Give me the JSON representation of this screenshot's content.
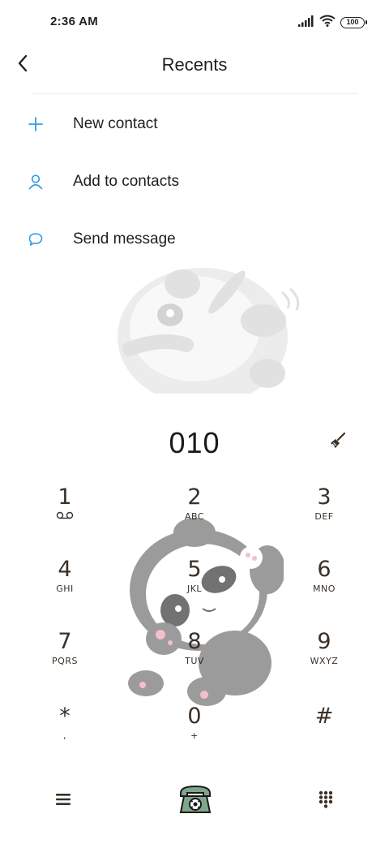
{
  "status_bar": {
    "time": "2:36 AM",
    "battery": "100",
    "icons": [
      "signal-icon",
      "wifi-icon",
      "battery-icon"
    ]
  },
  "header": {
    "title": "Recents",
    "back_icon": "chevron-left-icon"
  },
  "actions": [
    {
      "label": "New contact",
      "icon": "plus-icon"
    },
    {
      "label": "Add to contacts",
      "icon": "person-icon"
    },
    {
      "label": "Send message",
      "icon": "chat-bubble-icon"
    }
  ],
  "dialer": {
    "number": "010",
    "clear_icon": "broom-icon"
  },
  "keypad": {
    "keys": [
      {
        "digit": "1",
        "letters": "voicemail"
      },
      {
        "digit": "2",
        "letters": "ABC"
      },
      {
        "digit": "3",
        "letters": "DEF"
      },
      {
        "digit": "4",
        "letters": "GHI"
      },
      {
        "digit": "5",
        "letters": "JKL"
      },
      {
        "digit": "6",
        "letters": "MNO"
      },
      {
        "digit": "7",
        "letters": "PQRS"
      },
      {
        "digit": "8",
        "letters": "TUV"
      },
      {
        "digit": "9",
        "letters": "WXYZ"
      },
      {
        "digit": "*",
        "letters": ","
      },
      {
        "digit": "0",
        "letters": "+"
      },
      {
        "digit": "#",
        "letters": ""
      }
    ]
  },
  "bottom_bar": {
    "menu_icon": "menu-icon",
    "call_icon": "call-icon",
    "keypad_icon": "dialpad-icon"
  },
  "colors": {
    "accent": "#2f9be8",
    "key_text": "#3b3026",
    "text": "#1f1f1f"
  }
}
